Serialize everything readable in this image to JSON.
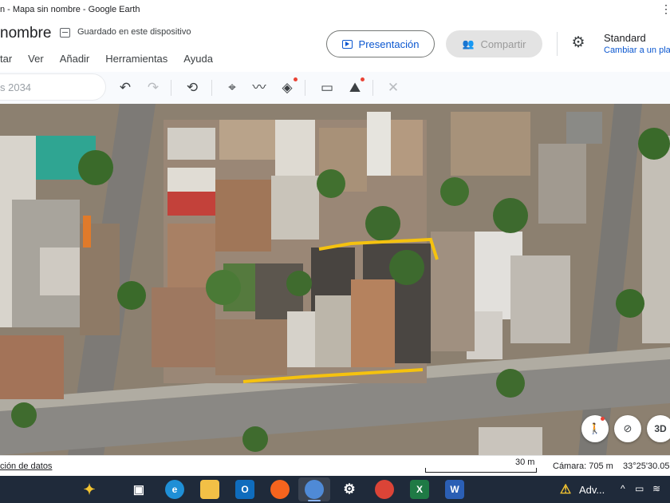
{
  "window": {
    "title": "n - Mapa sin nombre - Google Earth"
  },
  "header": {
    "project_name": "nombre",
    "save_status": "Guardado en este dispositivo",
    "menu": [
      "tar",
      "Ver",
      "Añadir",
      "Herramientas",
      "Ayuda"
    ],
    "present_label": "Presentación",
    "share_label": "Compartir",
    "map_style_title": "Standard",
    "map_style_sub": "Cambiar a un pla"
  },
  "toolbar": {
    "search_placeholder": "s 2034",
    "icons": [
      "undo-icon",
      "redo-icon",
      "history-icon",
      "placemark-icon",
      "path-icon",
      "layers-icon",
      "ruler-icon",
      "image-overlay-icon",
      "measure-disabled-icon"
    ]
  },
  "map": {
    "fab_3d_label": "3D",
    "fabs": [
      "pegman-icon",
      "compass-reset-icon",
      "3d-toggle"
    ]
  },
  "statusbar": {
    "data_link": "ción de datos",
    "scale_label": "30 m",
    "camera": "Cámara: 705 m",
    "coords": "33°25'30.05"
  },
  "taskbar": {
    "apps": [
      "copilot-icon",
      "task-view-icon",
      "edge-icon",
      "file-explorer-icon",
      "outlook-icon",
      "firefox-icon",
      "google-earth-icon",
      "settings-icon",
      "chrome-icon",
      "excel-icon",
      "word-icon"
    ],
    "alert_label": "Adv...",
    "colors": {
      "background": "#1f2a3a",
      "accent": "#0b57d0"
    }
  }
}
